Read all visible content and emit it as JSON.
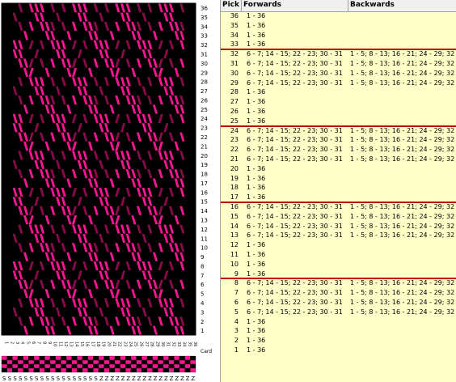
{
  "colors": {
    "pink": "#ff1493",
    "magenta": "#8b0a4a",
    "black": "#000000",
    "red_divider": "#c00000",
    "table_bg": "#ffffc8"
  },
  "table": {
    "headers": {
      "pick": "Pick",
      "forwards": "Forwards",
      "backwards": "Backwards"
    },
    "rows": [
      {
        "pick": "36",
        "forwards": "1 - 36",
        "backwards": ""
      },
      {
        "pick": "35",
        "forwards": "1 - 36",
        "backwards": ""
      },
      {
        "pick": "34",
        "forwards": "1 - 36",
        "backwards": ""
      },
      {
        "pick": "33",
        "forwards": "1 - 36",
        "backwards": ""
      },
      {
        "pick": "32",
        "forwards": "6 - 7; 14 - 15; 22 - 23; 30 - 31",
        "backwards": "1 - 5; 8 - 13; 16 - 21; 24 - 29; 32 - 36"
      },
      {
        "pick": "31",
        "forwards": "6 - 7; 14 - 15; 22 - 23; 30 - 31",
        "backwards": "1 - 5; 8 - 13; 16 - 21; 24 - 29; 32 - 36"
      },
      {
        "pick": "30",
        "forwards": "6 - 7; 14 - 15; 22 - 23; 30 - 31",
        "backwards": "1 - 5; 8 - 13; 16 - 21; 24 - 29; 32 - 36"
      },
      {
        "pick": "29",
        "forwards": "6 - 7; 14 - 15; 22 - 23; 30 - 31",
        "backwards": "1 - 5; 8 - 13; 16 - 21; 24 - 29; 32 - 36"
      },
      {
        "pick": "28",
        "forwards": "1 - 36",
        "backwards": ""
      },
      {
        "pick": "27",
        "forwards": "1 - 36",
        "backwards": ""
      },
      {
        "pick": "26",
        "forwards": "1 - 36",
        "backwards": ""
      },
      {
        "pick": "25",
        "forwards": "1 - 36",
        "backwards": ""
      },
      {
        "pick": "24",
        "forwards": "6 - 7; 14 - 15; 22 - 23; 30 - 31",
        "backwards": "1 - 5; 8 - 13; 16 - 21; 24 - 29; 32 - 36"
      },
      {
        "pick": "23",
        "forwards": "6 - 7; 14 - 15; 22 - 23; 30 - 31",
        "backwards": "1 - 5; 8 - 13; 16 - 21; 24 - 29; 32 - 36"
      },
      {
        "pick": "22",
        "forwards": "6 - 7; 14 - 15; 22 - 23; 30 - 31",
        "backwards": "1 - 5; 8 - 13; 16 - 21; 24 - 29; 32 - 36"
      },
      {
        "pick": "21",
        "forwards": "6 - 7; 14 - 15; 22 - 23; 30 - 31",
        "backwards": "1 - 5; 8 - 13; 16 - 21; 24 - 29; 32 - 36"
      },
      {
        "pick": "20",
        "forwards": "1 - 36",
        "backwards": ""
      },
      {
        "pick": "19",
        "forwards": "1 - 36",
        "backwards": ""
      },
      {
        "pick": "18",
        "forwards": "1 - 36",
        "backwards": ""
      },
      {
        "pick": "17",
        "forwards": "1 - 36",
        "backwards": ""
      },
      {
        "pick": "16",
        "forwards": "6 - 7; 14 - 15; 22 - 23; 30 - 31",
        "backwards": "1 - 5; 8 - 13; 16 - 21; 24 - 29; 32 - 36"
      },
      {
        "pick": "15",
        "forwards": "6 - 7; 14 - 15; 22 - 23; 30 - 31",
        "backwards": "1 - 5; 8 - 13; 16 - 21; 24 - 29; 32 - 36"
      },
      {
        "pick": "14",
        "forwards": "6 - 7; 14 - 15; 22 - 23; 30 - 31",
        "backwards": "1 - 5; 8 - 13; 16 - 21; 24 - 29; 32 - 36"
      },
      {
        "pick": "13",
        "forwards": "6 - 7; 14 - 15; 22 - 23; 30 - 31",
        "backwards": "1 - 5; 8 - 13; 16 - 21; 24 - 29; 32 - 36"
      },
      {
        "pick": "12",
        "forwards": "1 - 36",
        "backwards": ""
      },
      {
        "pick": "11",
        "forwards": "1 - 36",
        "backwards": ""
      },
      {
        "pick": "10",
        "forwards": "1 - 36",
        "backwards": ""
      },
      {
        "pick": "9",
        "forwards": "1 - 36",
        "backwards": ""
      },
      {
        "pick": "8",
        "forwards": "6 - 7; 14 - 15; 22 - 23; 30 - 31",
        "backwards": "1 - 5; 8 - 13; 16 - 21; 24 - 29; 32 - 36"
      },
      {
        "pick": "7",
        "forwards": "6 - 7; 14 - 15; 22 - 23; 30 - 31",
        "backwards": "1 - 5; 8 - 13; 16 - 21; 24 - 29; 32 - 36"
      },
      {
        "pick": "6",
        "forwards": "6 - 7; 14 - 15; 22 - 23; 30 - 31",
        "backwards": "1 - 5; 8 - 13; 16 - 21; 24 - 29; 32 - 36"
      },
      {
        "pick": "5",
        "forwards": "6 - 7; 14 - 15; 22 - 23; 30 - 31",
        "backwards": "1 - 5; 8 - 13; 16 - 21; 24 - 29; 32 - 36"
      },
      {
        "pick": "4",
        "forwards": "1 - 36",
        "backwards": ""
      },
      {
        "pick": "3",
        "forwards": "1 - 36",
        "backwards": ""
      },
      {
        "pick": "2",
        "forwards": "1 - 36",
        "backwards": ""
      },
      {
        "pick": "1",
        "forwards": "1 - 36",
        "backwards": ""
      }
    ]
  },
  "pattern": {
    "pick_labels": [
      "36",
      "35",
      "34",
      "33",
      "32",
      "31",
      "30",
      "29",
      "28",
      "27",
      "26",
      "25",
      "24",
      "23",
      "22",
      "21",
      "20",
      "19",
      "18",
      "17",
      "16",
      "15",
      "14",
      "13",
      "12",
      "11",
      "10",
      "9",
      "8",
      "7",
      "6",
      "5",
      "4",
      "3",
      "2",
      "1"
    ],
    "card_label": "Card",
    "threading_label": "S",
    "twist_label": "Z"
  }
}
